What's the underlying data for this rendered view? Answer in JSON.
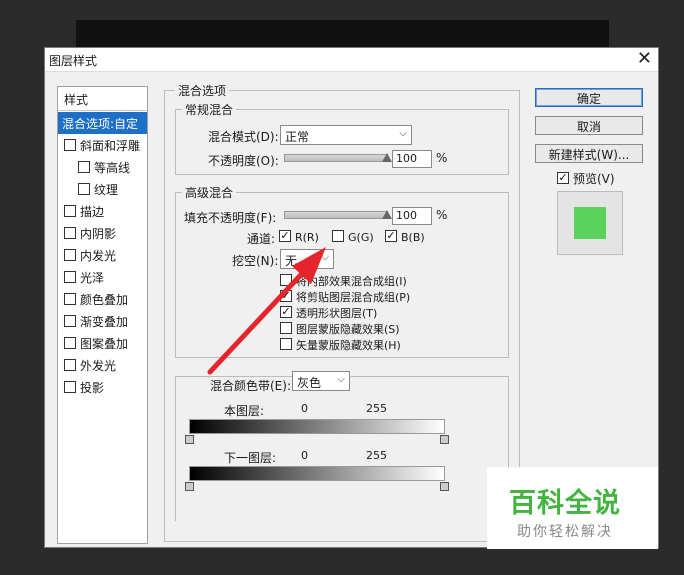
{
  "window": {
    "title": "图层样式",
    "close_glyph": "✕"
  },
  "sidebar": {
    "header": "样式",
    "items": [
      {
        "label": "混合选项:自定",
        "checkbox": false,
        "selected": true
      },
      {
        "label": "斜面和浮雕",
        "checkbox": true,
        "checked": false
      },
      {
        "label": "等高线",
        "checkbox": true,
        "checked": false,
        "indent": true
      },
      {
        "label": "纹理",
        "checkbox": true,
        "checked": false,
        "indent": true
      },
      {
        "label": "描边",
        "checkbox": true,
        "checked": false
      },
      {
        "label": "内阴影",
        "checkbox": true,
        "checked": false
      },
      {
        "label": "内发光",
        "checkbox": true,
        "checked": false
      },
      {
        "label": "光泽",
        "checkbox": true,
        "checked": false
      },
      {
        "label": "颜色叠加",
        "checkbox": true,
        "checked": false
      },
      {
        "label": "渐变叠加",
        "checkbox": true,
        "checked": false
      },
      {
        "label": "图案叠加",
        "checkbox": true,
        "checked": false
      },
      {
        "label": "外发光",
        "checkbox": true,
        "checked": false
      },
      {
        "label": "投影",
        "checkbox": true,
        "checked": false
      }
    ]
  },
  "blend": {
    "title": "混合选项",
    "general": {
      "title": "常规混合",
      "mode_label": "混合模式(D):",
      "mode_value": "正常",
      "opacity_label": "不透明度(O):",
      "opacity_value": "100",
      "opacity_unit": "%",
      "opacity_level": 1.0
    },
    "advanced": {
      "title": "高级混合",
      "fill_label": "填充不透明度(F):",
      "fill_value": "100",
      "fill_unit": "%",
      "fill_level": 1.0,
      "channels_label": "通道:",
      "channels": [
        {
          "label": "R(R)",
          "checked": true
        },
        {
          "label": "G(G)",
          "checked": false
        },
        {
          "label": "B(B)",
          "checked": true
        }
      ],
      "knockout_label": "挖空(N):",
      "knockout_value": "无",
      "options": [
        {
          "label": "将内部效果混合成组(I)",
          "checked": false
        },
        {
          "label": "将剪贴图层混合成组(P)",
          "checked": true
        },
        {
          "label": "透明形状图层(T)",
          "checked": true
        },
        {
          "label": "图层蒙版隐藏效果(S)",
          "checked": false
        },
        {
          "label": "矢量蒙版隐藏效果(H)",
          "checked": false
        }
      ]
    },
    "blend_if": {
      "label": "混合颜色带(E):",
      "value": "灰色",
      "this_layer_label": "本图层:",
      "this_layer_min": "0",
      "this_layer_max": "255",
      "under_layer_label": "下一图层:",
      "under_layer_min": "0",
      "under_layer_max": "255"
    }
  },
  "buttons": {
    "ok": "确定",
    "cancel": "取消",
    "new_style": "新建样式(W)...",
    "preview_label": "预览(V)",
    "preview_checked": true
  },
  "colors": {
    "preview_swatch": "#5bd25b",
    "selected_bg": "#1e6fc8",
    "arrow": "#e5242b",
    "watermark_green": "#42b43f"
  },
  "watermark": {
    "main": "百科全说",
    "sub": "助你轻松解决"
  }
}
